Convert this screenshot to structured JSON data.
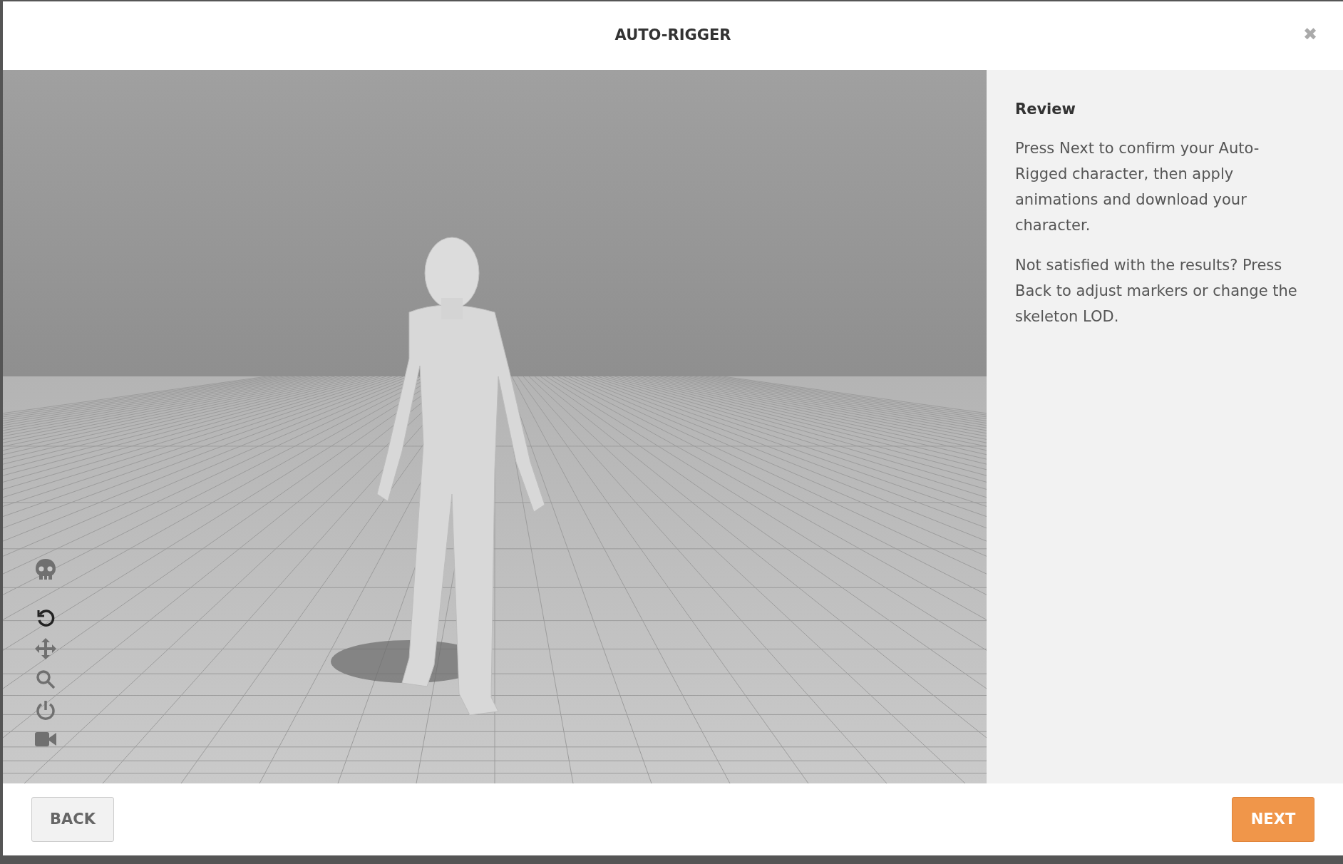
{
  "dialog": {
    "title": "AUTO-RIGGER",
    "close": "✖"
  },
  "viewport": {
    "tools": [
      {
        "kind": "skeleton",
        "selected": false
      },
      {
        "kind": "rotate",
        "selected": true
      },
      {
        "kind": "pan",
        "selected": false
      },
      {
        "kind": "zoom",
        "selected": false
      },
      {
        "kind": "power",
        "selected": false
      },
      {
        "kind": "camera",
        "selected": false
      }
    ]
  },
  "panel": {
    "heading": "Review",
    "paragraphs": [
      "Press Next to confirm your Auto-Rigged character, then apply animations and download your character.",
      "Not satisfied with the results? Press Back to adjust markers or change the skeleton LOD."
    ]
  },
  "footer": {
    "back": "BACK",
    "next": "NEXT"
  }
}
